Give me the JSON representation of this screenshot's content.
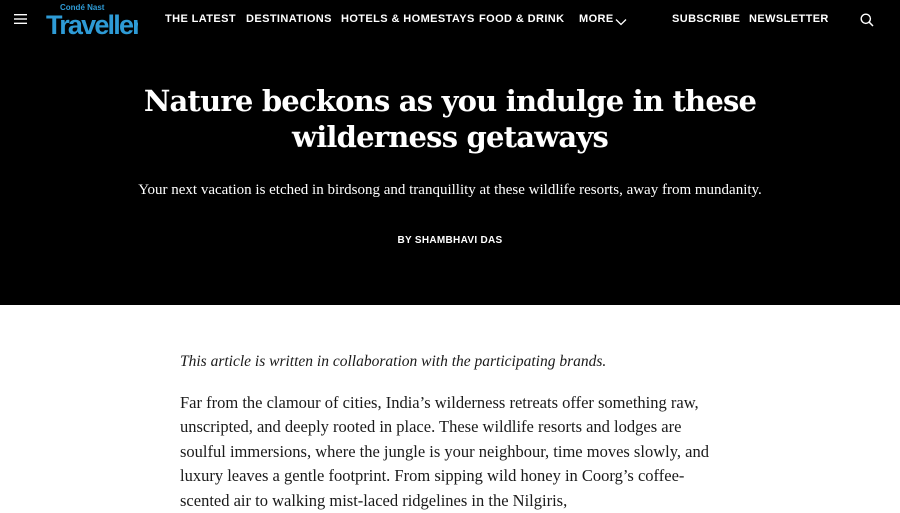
{
  "nav": {
    "menu_icon": "hamburger-menu-icon",
    "logo_top": "Condé Nast",
    "logo_main": "Traveller",
    "items": [
      "THE LATEST",
      "DESTINATIONS",
      "HOTELS & HOMESTAYS",
      "FOOD & DRINK",
      "MORE"
    ],
    "more_icon": "chevron-down-icon",
    "subscribe": "SUBSCRIBE",
    "newsletter": "NEWSLETTER",
    "search_icon": "search-icon"
  },
  "hero": {
    "headline": "Nature beckons as you indulge in these wilderness getaways",
    "dek": "Your next vacation is etched in birdsong and tranquillity at these wildlife resorts, away from mundanity.",
    "byline": "BY SHAMBHAVI DAS"
  },
  "article": {
    "disclaimer": "This article is written in collaboration with the participating brands.",
    "body": "Far from the clamour of cities, India’s wilderness retreats offer something raw, unscripted, and deeply rooted in place. These wildlife resorts and lodges are soulful immersions, where the jungle is your neighbour, time moves slowly, and luxury leaves a gentle footprint. From sipping wild honey in Coorg’s coffee-scented air to walking mist-laced ridgelines in the Nilgiris,"
  },
  "colors": {
    "hero_bg": "#000000",
    "logo_blue": "#2e9bd6",
    "body_text": "#1a1a1a"
  }
}
